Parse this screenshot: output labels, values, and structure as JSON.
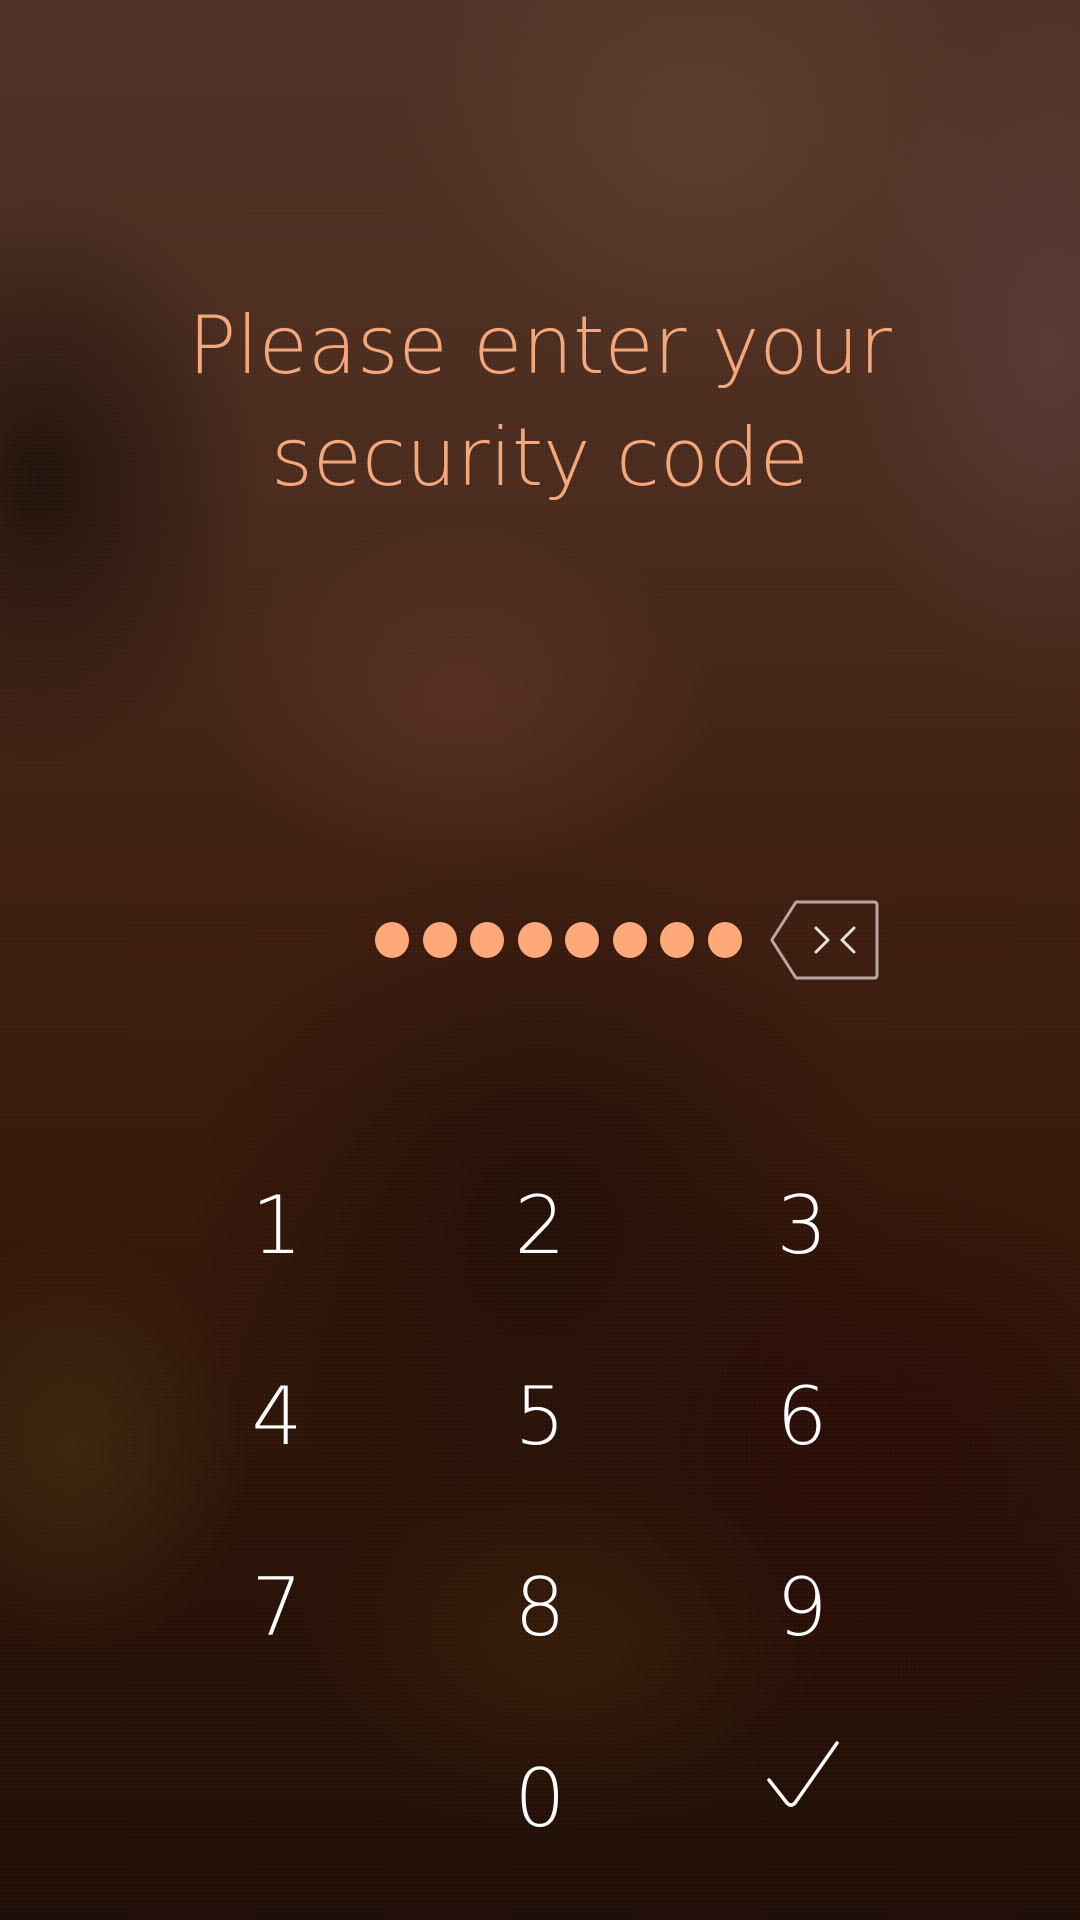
{
  "prompt": {
    "line1": "Please enter your",
    "line2": "security code"
  },
  "code": {
    "entered_digits": 8,
    "dot_color": "#ffa97a"
  },
  "backspace": {
    "icon": "backspace-icon"
  },
  "keypad": {
    "keys": [
      "1",
      "2",
      "3",
      "4",
      "5",
      "6",
      "7",
      "8",
      "9",
      "0"
    ],
    "confirm_icon": "checkmark-icon"
  },
  "colors": {
    "prompt_text": "#f4a77b",
    "key_text": "#ffffff",
    "accent": "#ffa97a"
  }
}
